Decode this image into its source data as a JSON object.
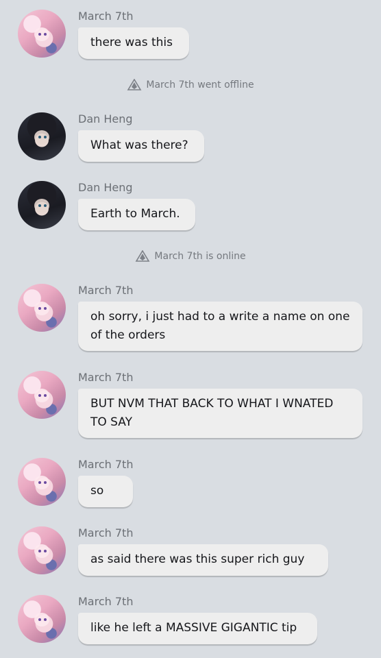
{
  "messages": [
    {
      "sender": "March 7th",
      "text": "there was this"
    },
    {
      "sender": "Dan Heng",
      "text": "What was there?"
    },
    {
      "sender": "Dan Heng",
      "text": "Earth to March."
    },
    {
      "sender": "March 7th",
      "text": "oh sorry, i just had to a write a name on one of the orders"
    },
    {
      "sender": "March 7th",
      "text": "BUT NVM THAT BACK TO WHAT I WNATED TO SAY"
    },
    {
      "sender": "March 7th",
      "text": "so"
    },
    {
      "sender": "March 7th",
      "text": "as said there was this super rich guy"
    },
    {
      "sender": "March 7th",
      "text": "like he left a MASSIVE GIGANTIC tip"
    }
  ],
  "system": [
    {
      "text": "March 7th went offline",
      "icon": "offline-icon"
    },
    {
      "text": "March 7th is online",
      "icon": "online-icon"
    }
  ]
}
